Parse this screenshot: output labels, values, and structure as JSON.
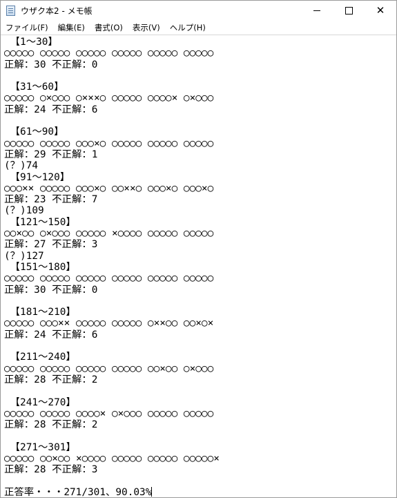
{
  "window": {
    "title": "ウザク本2 - メモ帳",
    "minimize_symbol": "—",
    "maximize_symbol": "☐",
    "close_symbol": "✕"
  },
  "menu": [
    "ファイル(F)",
    "編集(E)",
    "書式(O)",
    "表示(V)",
    "ヘルプ(H)"
  ],
  "document": {
    "lines": [
      " 【1～30】",
      "○○○○○ ○○○○○ ○○○○○ ○○○○○ ○○○○○ ○○○○○",
      "正解：30 不正解：0",
      "",
      " 【31～60】",
      "○○○○○ ○×○○○ ○×××○ ○○○○○ ○○○○× ○×○○○",
      "正解：24 不正解：6",
      "",
      " 【61～90】",
      "○○○○○ ○○○○○ ○○○×○ ○○○○○ ○○○○○ ○○○○○",
      "正解：29 不正解：1",
      "(？)74",
      " 【91～120】",
      "○○○×× ○○○○○ ○○○×○ ○○××○ ○○○×○ ○○○×○",
      "正解：23 不正解：7",
      "(？)109",
      " 【121～150】",
      "○○×○○ ○×○○○ ○○○○○ ×○○○○ ○○○○○ ○○○○○",
      "正解：27 不正解：3",
      "(？)127",
      " 【151～180】",
      "○○○○○ ○○○○○ ○○○○○ ○○○○○ ○○○○○ ○○○○○",
      "正解：30 不正解：0",
      "",
      " 【181～210】",
      "○○○○○ ○○○×× ○○○○○ ○○○○○ ○××○○ ○○×○×",
      "正解：24 不正解：6",
      "",
      " 【211～240】",
      "○○○○○ ○○○○○ ○○○○○ ○○○○○ ○○×○○ ○×○○○",
      "正解：28 不正解：2",
      "",
      " 【241～270】",
      "○○○○○ ○○○○○ ○○○○× ○×○○○ ○○○○○ ○○○○○",
      "正解：28 不正解：2",
      "",
      " 【271～301】",
      "○○○○○ ○○×○○ ×○○○○ ○○○○○ ○○○○○ ○○○○○×",
      "正解：28 不正解：3",
      "",
      "正答率・・・271/301、90.03%"
    ]
  }
}
